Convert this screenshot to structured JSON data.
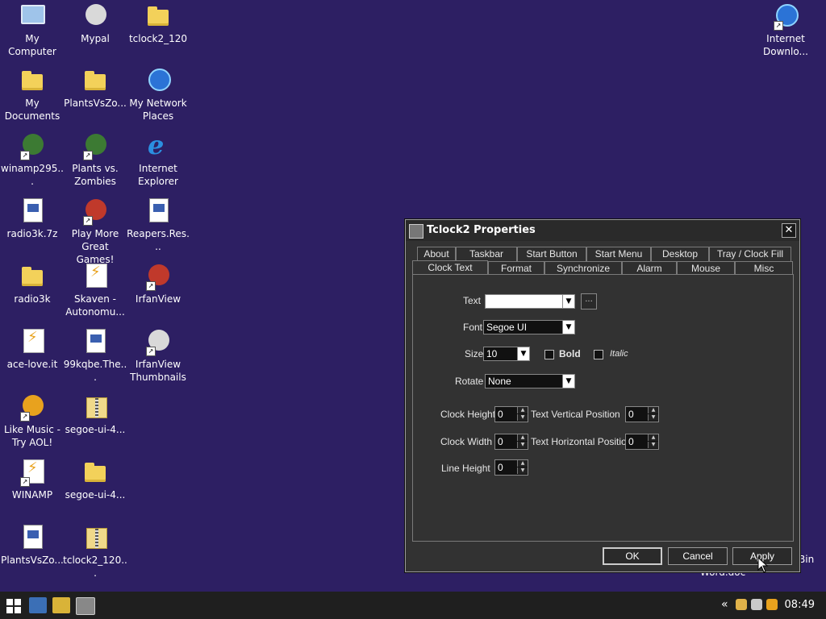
{
  "desktop": {
    "icons": [
      {
        "label": "My Computer"
      },
      {
        "label": "Mypal"
      },
      {
        "label": "tclock2_120"
      },
      {
        "label": "My Documents"
      },
      {
        "label": "PlantsVsZo..."
      },
      {
        "label": "My Network Places"
      },
      {
        "label": "winamp295..."
      },
      {
        "label": "Plants vs. Zombies"
      },
      {
        "label": "Internet Explorer"
      },
      {
        "label": "radio3k.7z"
      },
      {
        "label": "Play More Great Games!"
      },
      {
        "label": "Reapers.Res..."
      },
      {
        "label": "radio3k"
      },
      {
        "label": "Skaven - Autonomu..."
      },
      {
        "label": "IrfanView"
      },
      {
        "label": "ace-love.it"
      },
      {
        "label": "99kqbe.The..."
      },
      {
        "label": "IrfanView Thumbnails"
      },
      {
        "label": "Like Music - Try AOL!"
      },
      {
        "label": "segoe-ui-4..."
      },
      {
        "label": "WINAMP"
      },
      {
        "label": "segoe-ui-4..."
      },
      {
        "label": "PlantsVsZo..."
      },
      {
        "label": "tclock2_120..."
      },
      {
        "label": "Internet Downlo..."
      }
    ],
    "partial_behind": {
      "text1": "Bin",
      "text2": "Word.doc"
    }
  },
  "dialog": {
    "title": "Tclock2 Properties",
    "close": "✕",
    "tabs_row1": [
      "About",
      "Taskbar",
      "Start Button",
      "Start Menu",
      "Desktop",
      "Tray / Clock Fill"
    ],
    "tabs_row2": [
      "Clock Text",
      "Format",
      "Synchronize",
      "Alarm",
      "Mouse",
      "Misc"
    ],
    "text_label": "Text",
    "text_value": "",
    "browse": "...",
    "font_label": "Font",
    "font_value": "Segoe UI",
    "size_label": "Size",
    "size_value": "10",
    "bold_label": "Bold",
    "italic_label": "Italic",
    "rotate_label": "Rotate",
    "rotate_value": "None",
    "clock_height_label": "Clock Height",
    "clock_height_value": "0",
    "text_vertical_label": "Text Vertical Position",
    "text_vertical_value": "0",
    "clock_width_label": "Clock Width",
    "clock_width_value": "0",
    "text_horizontal_label": "Text Horizontal Position",
    "text_horizontal_value": "0",
    "line_height_label": "Line Height",
    "line_height_value": "0",
    "ok": "OK",
    "cancel": "Cancel",
    "apply": "Apply"
  },
  "taskbar": {
    "time": "08:49",
    "overflow": "«"
  }
}
